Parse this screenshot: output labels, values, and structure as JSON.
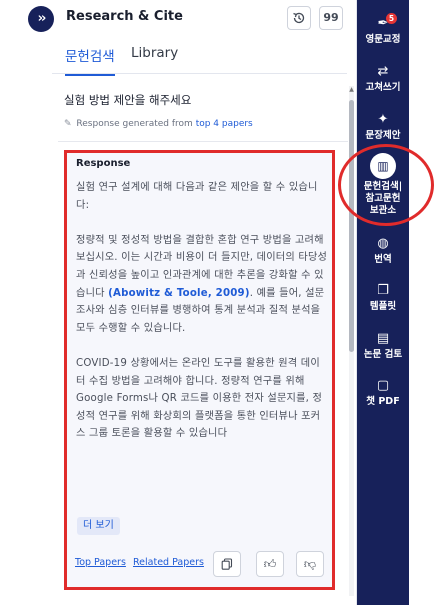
{
  "header": {
    "title": "Research & Cite",
    "quote_icon_text": "99"
  },
  "tabs": [
    {
      "label": "문헌검색",
      "active": true
    },
    {
      "label": "Library",
      "active": false
    }
  ],
  "query": "실험 방법 제안을 해주세요",
  "generated": {
    "prefix": "Response generated from",
    "link": "top 4 papers"
  },
  "response": {
    "title": "Response",
    "p1": "실험 연구 설계에 대해 다음과 같은 제안을 할 수 있습니다:",
    "p2_before": "정량적 및 정성적 방법을 결합한 혼합 연구 방법을 고려해 보십시오. 이는 시간과 비용이 더 들지만, 데이터의 타당성과 신뢰성을 높이고 인과관계에 대한 추론을 강화할 수 있습니다 ",
    "citation": "(Abowitz & Toole, 2009)",
    "p2_after": ". 예를 들어, 설문조사와 심층 인터뷰를 병행하여 통계 분석과 질적 분석을 모두 수행할 수 있습니다.",
    "p3": "COVID-19 상황에서는 온라인 도구를 활용한 원격 데이터 수집 방법을 고려해야 합니다. 정량적 연구를 위해 Google Forms나 QR 코드를 이용한 전자 설문지를, 정성적 연구를 위해 화상회의 플랫폼을 통한 인터뷰나 포커스 그룹 토론을 활용할 수 있습니다",
    "more_label": "더 보기",
    "top_papers": "Top Papers",
    "related_papers": "Related Papers"
  },
  "sidebar": {
    "items": [
      {
        "label": "영문교정",
        "icon": "pen-icon",
        "badge": "5"
      },
      {
        "label": "고쳐쓰기",
        "icon": "rewrite-icon"
      },
      {
        "label": "문장제안",
        "icon": "sparkle-icon"
      },
      {
        "label_line1": "문헌검색|",
        "label_line2": "참고문헌",
        "label_line3": "보관소",
        "icon": "books-icon",
        "active": true
      },
      {
        "label": "번역",
        "icon": "globe-icon"
      },
      {
        "label": "템플릿",
        "icon": "template-icon"
      },
      {
        "label": "논문 검토",
        "icon": "review-icon"
      },
      {
        "label": "챗 PDF",
        "icon": "chat-icon"
      }
    ]
  },
  "colors": {
    "sidebar_bg": "#17215a",
    "accent": "#1f5bd6",
    "highlight": "#e02b2b",
    "badge": "#e53535"
  }
}
